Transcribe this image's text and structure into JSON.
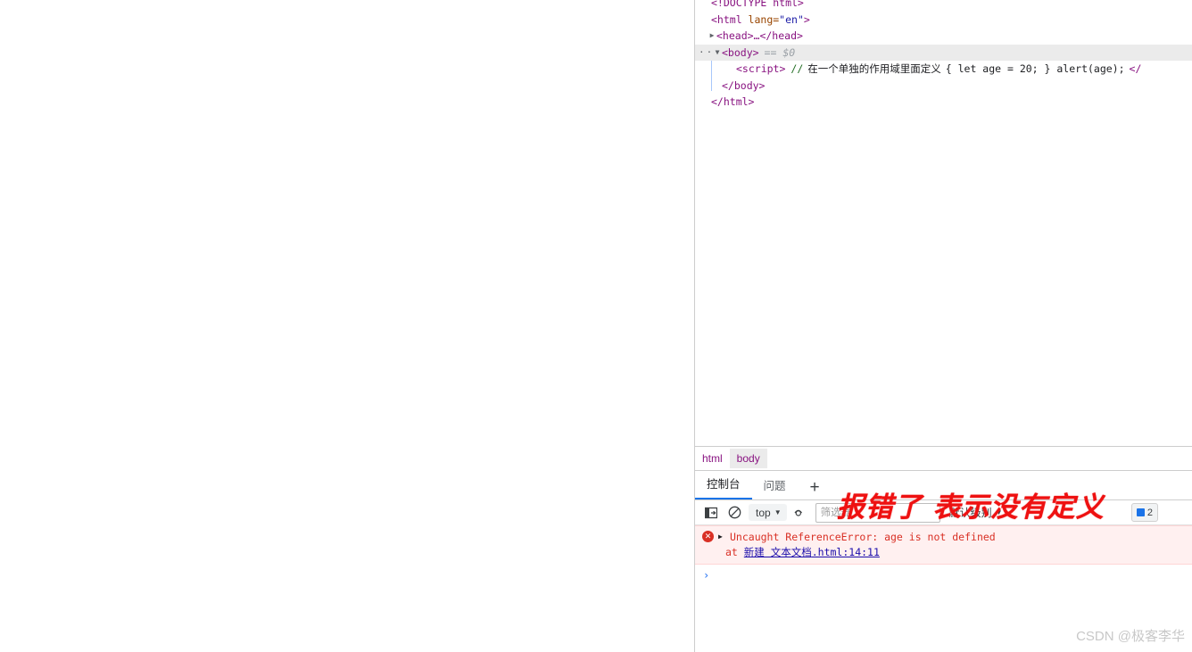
{
  "dom_tree": {
    "rows": [
      {
        "id": "doctype",
        "text": "<!DOCTYPE html>",
        "indent": 18,
        "selected": false
      },
      {
        "id": "html-open",
        "tag_open": "<html",
        "attr_name": " lang=",
        "attr_value": "\"en\"",
        "tag_close": ">",
        "indent": 18,
        "selected": false
      },
      {
        "id": "head-collapsed",
        "text": "<head>…</head>",
        "twisty": "▶",
        "indent": 24,
        "selected": false
      },
      {
        "id": "body-open",
        "text": "<body>",
        "twisty": "▼",
        "gutter": "···",
        "suffix": "== $0",
        "indent": 30,
        "selected": true
      },
      {
        "id": "script-line",
        "indent": 46,
        "selected": false,
        "tag": "<script>",
        "comment_slashes": "//",
        "comment_cn": "在一个单独的作用域里面定义",
        "code": "{ let age = 20; } alert(age);",
        "tag_end": "</"
      },
      {
        "id": "body-close",
        "text": "</body>",
        "indent": 30,
        "selected": false
      },
      {
        "id": "html-close",
        "text": "</html>",
        "indent": 18,
        "selected": false
      }
    ]
  },
  "breadcrumb": {
    "items": [
      {
        "label": "html",
        "active": false
      },
      {
        "label": "body",
        "active": true
      }
    ]
  },
  "drawer": {
    "tabs": [
      {
        "label": "控制台",
        "active": true
      },
      {
        "label": "问题",
        "active": false
      }
    ],
    "add_tab_label": "+"
  },
  "console_toolbar": {
    "sidebar_icon": "show-console-sidebar-icon",
    "clear_icon": "clear-console-icon",
    "context": "top",
    "context_caret": "▼",
    "eye_icon": "live-expression-icon",
    "filter_placeholder": "筛选器",
    "filter_value": "",
    "level": "默认级别",
    "level_caret": "▼",
    "issues_count": "2"
  },
  "console_messages": {
    "error": {
      "icon": "error-icon",
      "expand_arrow": "▶",
      "text": "Uncaught ReferenceError: age is not defined",
      "at_label": "at",
      "link_text": "新建  文本文档",
      "link_suffix": ".html:14:11"
    },
    "prompt_symbol": "›"
  },
  "annotation": {
    "text": "报错了 表示没有定义",
    "color": "#ee1111"
  },
  "watermark": {
    "text": "CSDN @极客李华"
  },
  "colors": {
    "accent": "#1a73e8",
    "error": "#d93025",
    "tagname": "#881280",
    "attrvalue": "#1a1aa6",
    "link": "#1a0dab"
  }
}
